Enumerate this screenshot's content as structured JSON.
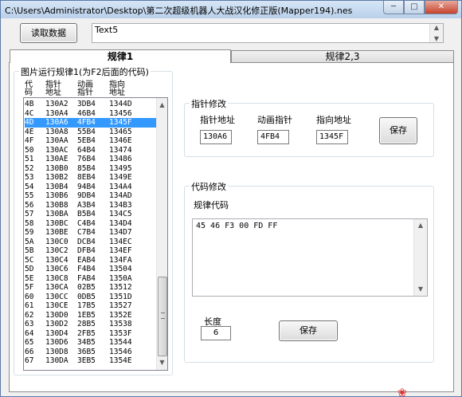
{
  "window": {
    "title": "C:\\Users\\Administrator\\Desktop\\第二次超级机器人大战汉化修正版(Mapper194).nes"
  },
  "toolbar": {
    "read_button": "读取数据",
    "text_value": "Text5"
  },
  "tabs": [
    {
      "label": "规律1"
    },
    {
      "label": "规律2,3"
    }
  ],
  "list_group": {
    "title": "图片运行规律1(为F2后面的代码)",
    "headers": {
      "code": "代\n码",
      "pointer": "指针\n地址",
      "anim": "动画\n指针",
      "dir": "指向\n地址"
    },
    "rows": [
      [
        "4B",
        "130A2",
        "3DB4",
        "1344D"
      ],
      [
        "4C",
        "130A4",
        "46B4",
        "13456"
      ],
      [
        "4D",
        "130A6",
        "4FB4",
        "1345F"
      ],
      [
        "4E",
        "130A8",
        "55B4",
        "13465"
      ],
      [
        "4F",
        "130AA",
        "5EB4",
        "1346E"
      ],
      [
        "50",
        "130AC",
        "64B4",
        "13474"
      ],
      [
        "51",
        "130AE",
        "76B4",
        "13486"
      ],
      [
        "52",
        "130B0",
        "85B4",
        "13495"
      ],
      [
        "53",
        "130B2",
        "8EB4",
        "1349E"
      ],
      [
        "54",
        "130B4",
        "94B4",
        "134A4"
      ],
      [
        "55",
        "130B6",
        "9DB4",
        "134AD"
      ],
      [
        "56",
        "130B8",
        "A3B4",
        "134B3"
      ],
      [
        "57",
        "130BA",
        "B5B4",
        "134C5"
      ],
      [
        "58",
        "130BC",
        "C4B4",
        "134D4"
      ],
      [
        "59",
        "130BE",
        "C7B4",
        "134D7"
      ],
      [
        "5A",
        "130C0",
        "DCB4",
        "134EC"
      ],
      [
        "5B",
        "130C2",
        "DFB4",
        "134EF"
      ],
      [
        "5C",
        "130C4",
        "EAB4",
        "134FA"
      ],
      [
        "5D",
        "130C6",
        "F4B4",
        "13504"
      ],
      [
        "5E",
        "130C8",
        "FAB4",
        "1350A"
      ],
      [
        "5F",
        "130CA",
        "02B5",
        "13512"
      ],
      [
        "60",
        "130CC",
        "0DB5",
        "1351D"
      ],
      [
        "61",
        "130CE",
        "17B5",
        "13527"
      ],
      [
        "62",
        "130D0",
        "1EB5",
        "1352E"
      ],
      [
        "63",
        "130D2",
        "28B5",
        "13538"
      ],
      [
        "64",
        "130D4",
        "2FB5",
        "1353F"
      ],
      [
        "65",
        "130D6",
        "34B5",
        "13544"
      ],
      [
        "66",
        "130D8",
        "36B5",
        "13546"
      ],
      [
        "67",
        "130DA",
        "3EB5",
        "1354E"
      ]
    ],
    "selected_index": 2
  },
  "pointer_edit": {
    "title": "指针修改",
    "labels": {
      "pointer_addr": "指针地址",
      "anim_pointer": "动画指针",
      "target_addr": "指向地址"
    },
    "values": {
      "pointer_addr": "130A6",
      "anim_pointer": "4FB4",
      "target_addr": "1345F"
    },
    "save_label": "保存"
  },
  "code_edit": {
    "title": "代码修改",
    "rule_label": "规律代码",
    "code_value": "45 46 F3 00 FD FF",
    "length_label": "长度",
    "length_value": "6",
    "save_label": "保存"
  }
}
